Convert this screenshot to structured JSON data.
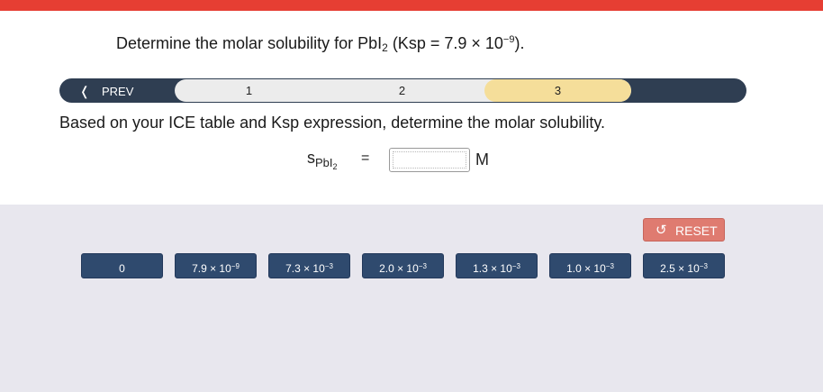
{
  "question": {
    "prefix": "Determine the molar solubility for PbI",
    "sub": "2",
    "middle": " (Ksp = 7.9 × 10",
    "exp": "−9",
    "suffix": ")."
  },
  "stepper": {
    "prev_label": "PREV",
    "steps": [
      "1",
      "2",
      "3"
    ],
    "active_step": "3"
  },
  "instruction": "Based on your ICE table and Ksp expression, determine the molar solubility.",
  "equation": {
    "symbol": "s",
    "symbol_sub": "PbI",
    "symbol_sub2": "2",
    "equals": "=",
    "answer_value": "",
    "unit": "M"
  },
  "tray": {
    "reset_label": "RESET",
    "tiles": [
      {
        "base": "0",
        "exp": ""
      },
      {
        "base": "7.9 × 10",
        "exp": "−9"
      },
      {
        "base": "7.3 × 10",
        "exp": "−3"
      },
      {
        "base": "2.0 × 10",
        "exp": "−3"
      },
      {
        "base": "1.3 × 10",
        "exp": "−3"
      },
      {
        "base": "1.0 × 10",
        "exp": "−3"
      },
      {
        "base": "2.5 × 10",
        "exp": "−3"
      }
    ]
  },
  "colors": {
    "top_bar": "#e63e33",
    "stepper_dark": "#2f3e52",
    "active_step": "#f5de9a",
    "tile": "#2f4a6e",
    "reset": "#df7b70",
    "tray_bg": "#e8e7ee"
  },
  "icons": {
    "prev": "chevron-left-icon",
    "reset": "undo-icon"
  }
}
